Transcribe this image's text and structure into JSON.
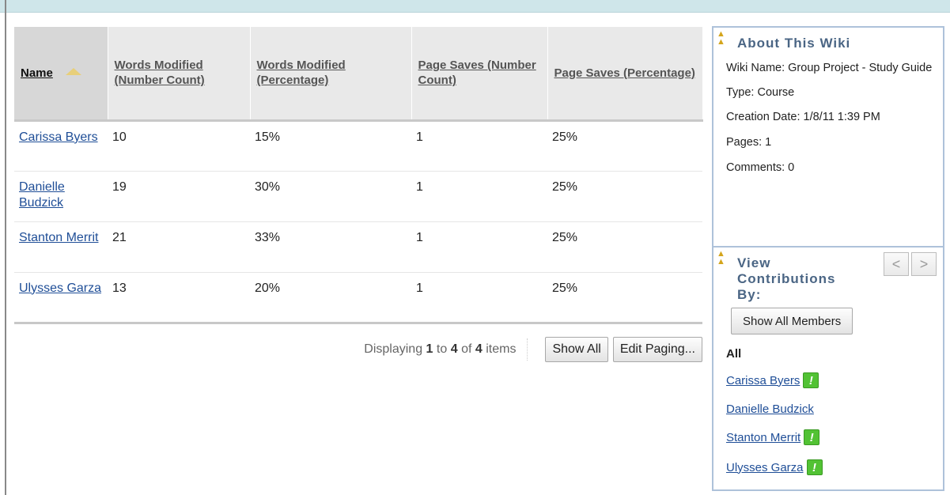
{
  "table": {
    "headers": [
      {
        "label": "Name"
      },
      {
        "label": "Words Modified (Number Count)"
      },
      {
        "label": "Words Modified (Percentage)"
      },
      {
        "label": "Page Saves (Number Count)"
      },
      {
        "label": "Page Saves (Percentage)"
      }
    ],
    "rows": [
      {
        "name": "Carissa Byers",
        "words_count": "10",
        "words_pct": "15%",
        "saves_count": "1",
        "saves_pct": "25%"
      },
      {
        "name": "Danielle Budzick",
        "words_count": "19",
        "words_pct": "30%",
        "saves_count": "1",
        "saves_pct": "25%"
      },
      {
        "name": "Stanton Merrit",
        "words_count": "21",
        "words_pct": "33%",
        "saves_count": "1",
        "saves_pct": "25%"
      },
      {
        "name": "Ulysses Garza",
        "words_count": "13",
        "words_pct": "20%",
        "saves_count": "1",
        "saves_pct": "25%"
      }
    ]
  },
  "pager": {
    "displaying": "Displaying",
    "from": "1",
    "to_word": "to",
    "to": "4",
    "of_word": "of",
    "total": "4",
    "items_word": "items",
    "show_all": "Show All",
    "edit_paging": "Edit Paging..."
  },
  "about": {
    "title": "About This Wiki",
    "wiki_name": "Wiki Name: Group Project - Study Guide",
    "type": "Type: Course",
    "creation_date": "Creation Date: 1/8/11 1:39 PM",
    "pages": "Pages: 1",
    "comments": "Comments: 0"
  },
  "contributions": {
    "title": "View Contributions By:",
    "prev_glyph": "<",
    "next_glyph": ">",
    "show_all_members": "Show All Members",
    "all_label": "All",
    "members": [
      {
        "name": "Carissa Byers",
        "has_alert": true
      },
      {
        "name": "Danielle Budzick",
        "has_alert": false
      },
      {
        "name": "Stanton Merrit",
        "has_alert": true
      },
      {
        "name": "Ulysses Garza",
        "has_alert": true
      }
    ],
    "alert_glyph": "!"
  },
  "colors": {
    "header_bar": "#cfe6ea",
    "panel_border": "#aec2da",
    "panel_title": "#4a6584",
    "link": "#1f4e97",
    "alert_green": "#52c234"
  }
}
